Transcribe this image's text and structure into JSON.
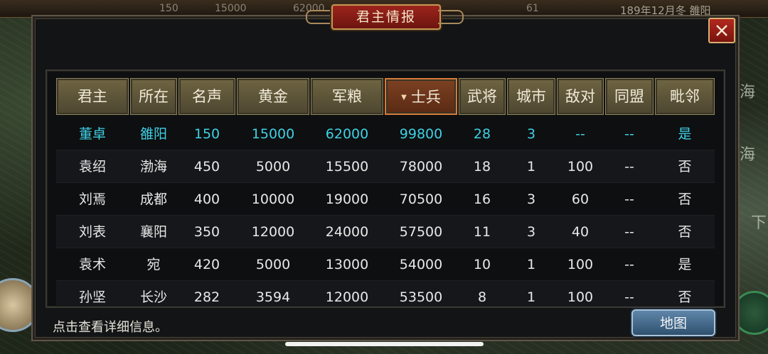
{
  "topbar": {
    "values": [
      "150",
      "15000",
      "62000",
      "61"
    ],
    "date": "189年12月冬 雒阳"
  },
  "map_labels": [
    "海",
    "海",
    "下"
  ],
  "panel": {
    "title": "君主情报",
    "close_label": "×"
  },
  "table": {
    "headers": [
      "君主",
      "所在",
      "名声",
      "黄金",
      "军粮",
      "士兵",
      "武将",
      "城市",
      "敌对",
      "同盟",
      "毗邻"
    ],
    "sorted_column": "士兵",
    "sort_arrow": "▼",
    "rows": [
      [
        "董卓",
        "雒阳",
        "150",
        "15000",
        "62000",
        "99800",
        "28",
        "3",
        "--",
        "--",
        "是"
      ],
      [
        "袁绍",
        "渤海",
        "450",
        "5000",
        "15500",
        "78000",
        "18",
        "1",
        "100",
        "--",
        "否"
      ],
      [
        "刘焉",
        "成都",
        "400",
        "10000",
        "19000",
        "70500",
        "16",
        "3",
        "60",
        "--",
        "否"
      ],
      [
        "刘表",
        "襄阳",
        "350",
        "12000",
        "24000",
        "57500",
        "11",
        "3",
        "40",
        "--",
        "否"
      ],
      [
        "袁术",
        "宛",
        "420",
        "5000",
        "13000",
        "54000",
        "10",
        "1",
        "100",
        "--",
        "是"
      ],
      [
        "孙坚",
        "长沙",
        "282",
        "3594",
        "12000",
        "53500",
        "8",
        "1",
        "100",
        "--",
        "否"
      ]
    ],
    "highlight_color": "#3fd0e4"
  },
  "footer": {
    "hint": "点击查看详细信息。",
    "map_button": "地图"
  }
}
